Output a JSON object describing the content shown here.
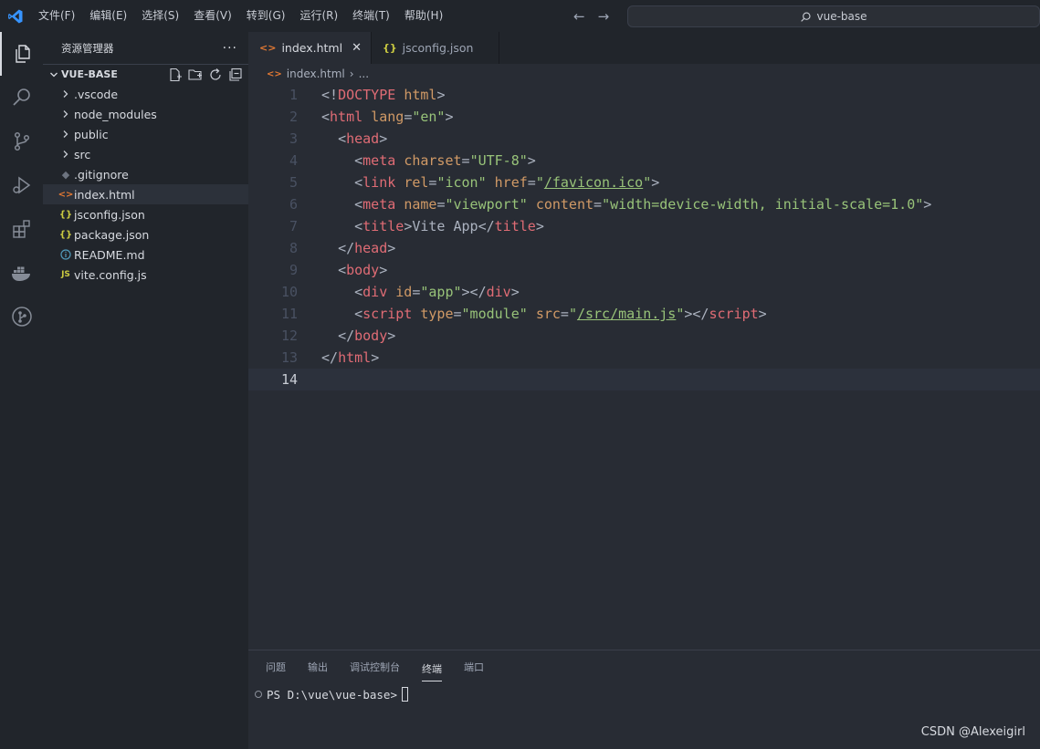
{
  "menu": [
    "文件(F)",
    "编辑(E)",
    "选择(S)",
    "查看(V)",
    "转到(G)",
    "运行(R)",
    "终端(T)",
    "帮助(H)"
  ],
  "search": {
    "label": "vue-base"
  },
  "sidebar": {
    "title": "资源管理器",
    "folder": "VUE-BASE",
    "items": [
      {
        "label": ".vscode",
        "kind": "folder"
      },
      {
        "label": "node_modules",
        "kind": "folder"
      },
      {
        "label": "public",
        "kind": "folder"
      },
      {
        "label": "src",
        "kind": "folder"
      },
      {
        "label": ".gitignore",
        "kind": "git"
      },
      {
        "label": "index.html",
        "kind": "html"
      },
      {
        "label": "jsconfig.json",
        "kind": "json"
      },
      {
        "label": "package.json",
        "kind": "json"
      },
      {
        "label": "README.md",
        "kind": "info"
      },
      {
        "label": "vite.config.js",
        "kind": "js"
      }
    ]
  },
  "tabs": [
    {
      "label": "index.html",
      "active": true
    },
    {
      "label": "jsconfig.json",
      "active": false
    }
  ],
  "breadcrumb": {
    "file": "index.html",
    "rest": "..."
  },
  "editor": {
    "current_line": 14,
    "lines": [
      {
        "n": "1",
        "html": "<span class='punct'>&lt;!</span><span class='doctype'>DOCTYPE</span> <span class='attr'>html</span><span class='punct'>&gt;</span>"
      },
      {
        "n": "2",
        "html": "<span class='punct'>&lt;</span><span class='tag'>html</span> <span class='attr'>lang</span><span class='punct'>=</span><span class='str'>\"en\"</span><span class='punct'>&gt;</span>"
      },
      {
        "n": "3",
        "html": "  <span class='punct'>&lt;</span><span class='tag'>head</span><span class='punct'>&gt;</span>"
      },
      {
        "n": "4",
        "html": "    <span class='punct'>&lt;</span><span class='tag'>meta</span> <span class='attr'>charset</span><span class='punct'>=</span><span class='str'>\"UTF-8\"</span><span class='punct'>&gt;</span>"
      },
      {
        "n": "5",
        "html": "    <span class='punct'>&lt;</span><span class='tag'>link</span> <span class='attr'>rel</span><span class='punct'>=</span><span class='str'>\"icon\"</span> <span class='attr'>href</span><span class='punct'>=</span><span class='str'>\"<span class='link'>/favicon.ico</span>\"</span><span class='punct'>&gt;</span>"
      },
      {
        "n": "6",
        "html": "    <span class='punct'>&lt;</span><span class='tag'>meta</span> <span class='attr'>name</span><span class='punct'>=</span><span class='str'>\"viewport\"</span> <span class='attr'>content</span><span class='punct'>=</span><span class='str'>\"width=device-width, initial-scale=1.0\"</span><span class='punct'>&gt;</span>"
      },
      {
        "n": "7",
        "html": "    <span class='punct'>&lt;</span><span class='tag'>title</span><span class='punct'>&gt;</span>Vite App<span class='punct'>&lt;/</span><span class='tag'>title</span><span class='punct'>&gt;</span>"
      },
      {
        "n": "8",
        "html": "  <span class='punct'>&lt;/</span><span class='tag'>head</span><span class='punct'>&gt;</span>"
      },
      {
        "n": "9",
        "html": "  <span class='punct'>&lt;</span><span class='tag'>body</span><span class='punct'>&gt;</span>"
      },
      {
        "n": "10",
        "html": "    <span class='punct'>&lt;</span><span class='tag'>div</span> <span class='attr'>id</span><span class='punct'>=</span><span class='str'>\"app\"</span><span class='punct'>&gt;&lt;/</span><span class='tag'>div</span><span class='punct'>&gt;</span>"
      },
      {
        "n": "11",
        "html": "    <span class='punct'>&lt;</span><span class='tag'>script</span> <span class='attr'>type</span><span class='punct'>=</span><span class='str'>\"module\"</span> <span class='attr'>src</span><span class='punct'>=</span><span class='str'>\"<span class='link'>/src/main.js</span>\"</span><span class='punct'>&gt;&lt;/</span><span class='tag'>script</span><span class='punct'>&gt;</span>"
      },
      {
        "n": "12",
        "html": "  <span class='punct'>&lt;/</span><span class='tag'>body</span><span class='punct'>&gt;</span>"
      },
      {
        "n": "13",
        "html": "<span class='punct'>&lt;/</span><span class='tag'>html</span><span class='punct'>&gt;</span>"
      },
      {
        "n": "14",
        "html": ""
      }
    ]
  },
  "panel": {
    "tabs": [
      {
        "label": "问题",
        "active": false
      },
      {
        "label": "输出",
        "active": false
      },
      {
        "label": "调试控制台",
        "active": false
      },
      {
        "label": "终端",
        "active": true
      },
      {
        "label": "端口",
        "active": false
      }
    ],
    "prompt": "PS D:\\vue\\vue-base>"
  },
  "watermark": "CSDN @Alexeigirl",
  "colors": {
    "accent_blue": "#3794ff",
    "tag": "#e06c75",
    "attr": "#d19a66",
    "string": "#98c379"
  }
}
